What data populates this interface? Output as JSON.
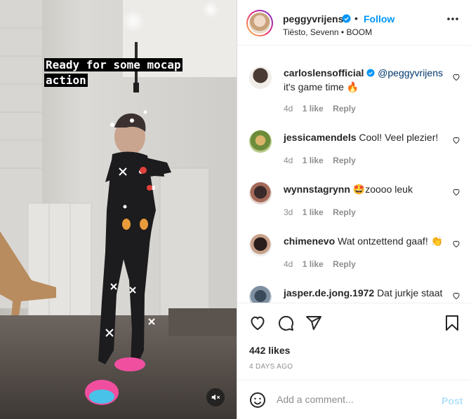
{
  "video": {
    "caption_line1": "Ready for some mocap",
    "caption_line2": "action",
    "mute_icon": "speaker-muted-icon"
  },
  "header": {
    "username": "peggyvrijens",
    "separator": "•",
    "follow_label": "Follow",
    "audio": "Tiësto, Sevenn • BOOM"
  },
  "comments": [
    {
      "username": "carloslensofficial",
      "verified": true,
      "mention": "@peggyvrijens",
      "text": "it's game time 🔥",
      "age": "4d",
      "likes": "1 like",
      "reply": "Reply"
    },
    {
      "username": "jessicamendels",
      "verified": false,
      "text": "Cool! Veel plezier!",
      "age": "4d",
      "likes": "1 like",
      "reply": "Reply"
    },
    {
      "username": "wynnstagrynn",
      "verified": false,
      "text": "🤩zoooo leuk",
      "age": "3d",
      "likes": "1 like",
      "reply": "Reply"
    },
    {
      "username": "chimenevo",
      "verified": false,
      "text": "Wat ontzettend gaaf! 👏",
      "age": "4d",
      "likes": "1 like",
      "reply": "Reply"
    },
    {
      "username": "jasper.de.jong.1972",
      "verified": false,
      "text": "Dat jurkje staat"
    }
  ],
  "actions": {
    "likes": "442 likes",
    "date": "4 DAYS AGO"
  },
  "add_comment": {
    "placeholder": "Add a comment...",
    "post_label": "Post"
  },
  "colors": {
    "accent": "#0095f6",
    "text": "#262626",
    "muted": "#8e8e8e",
    "post_disabled": "#b2dffc"
  }
}
